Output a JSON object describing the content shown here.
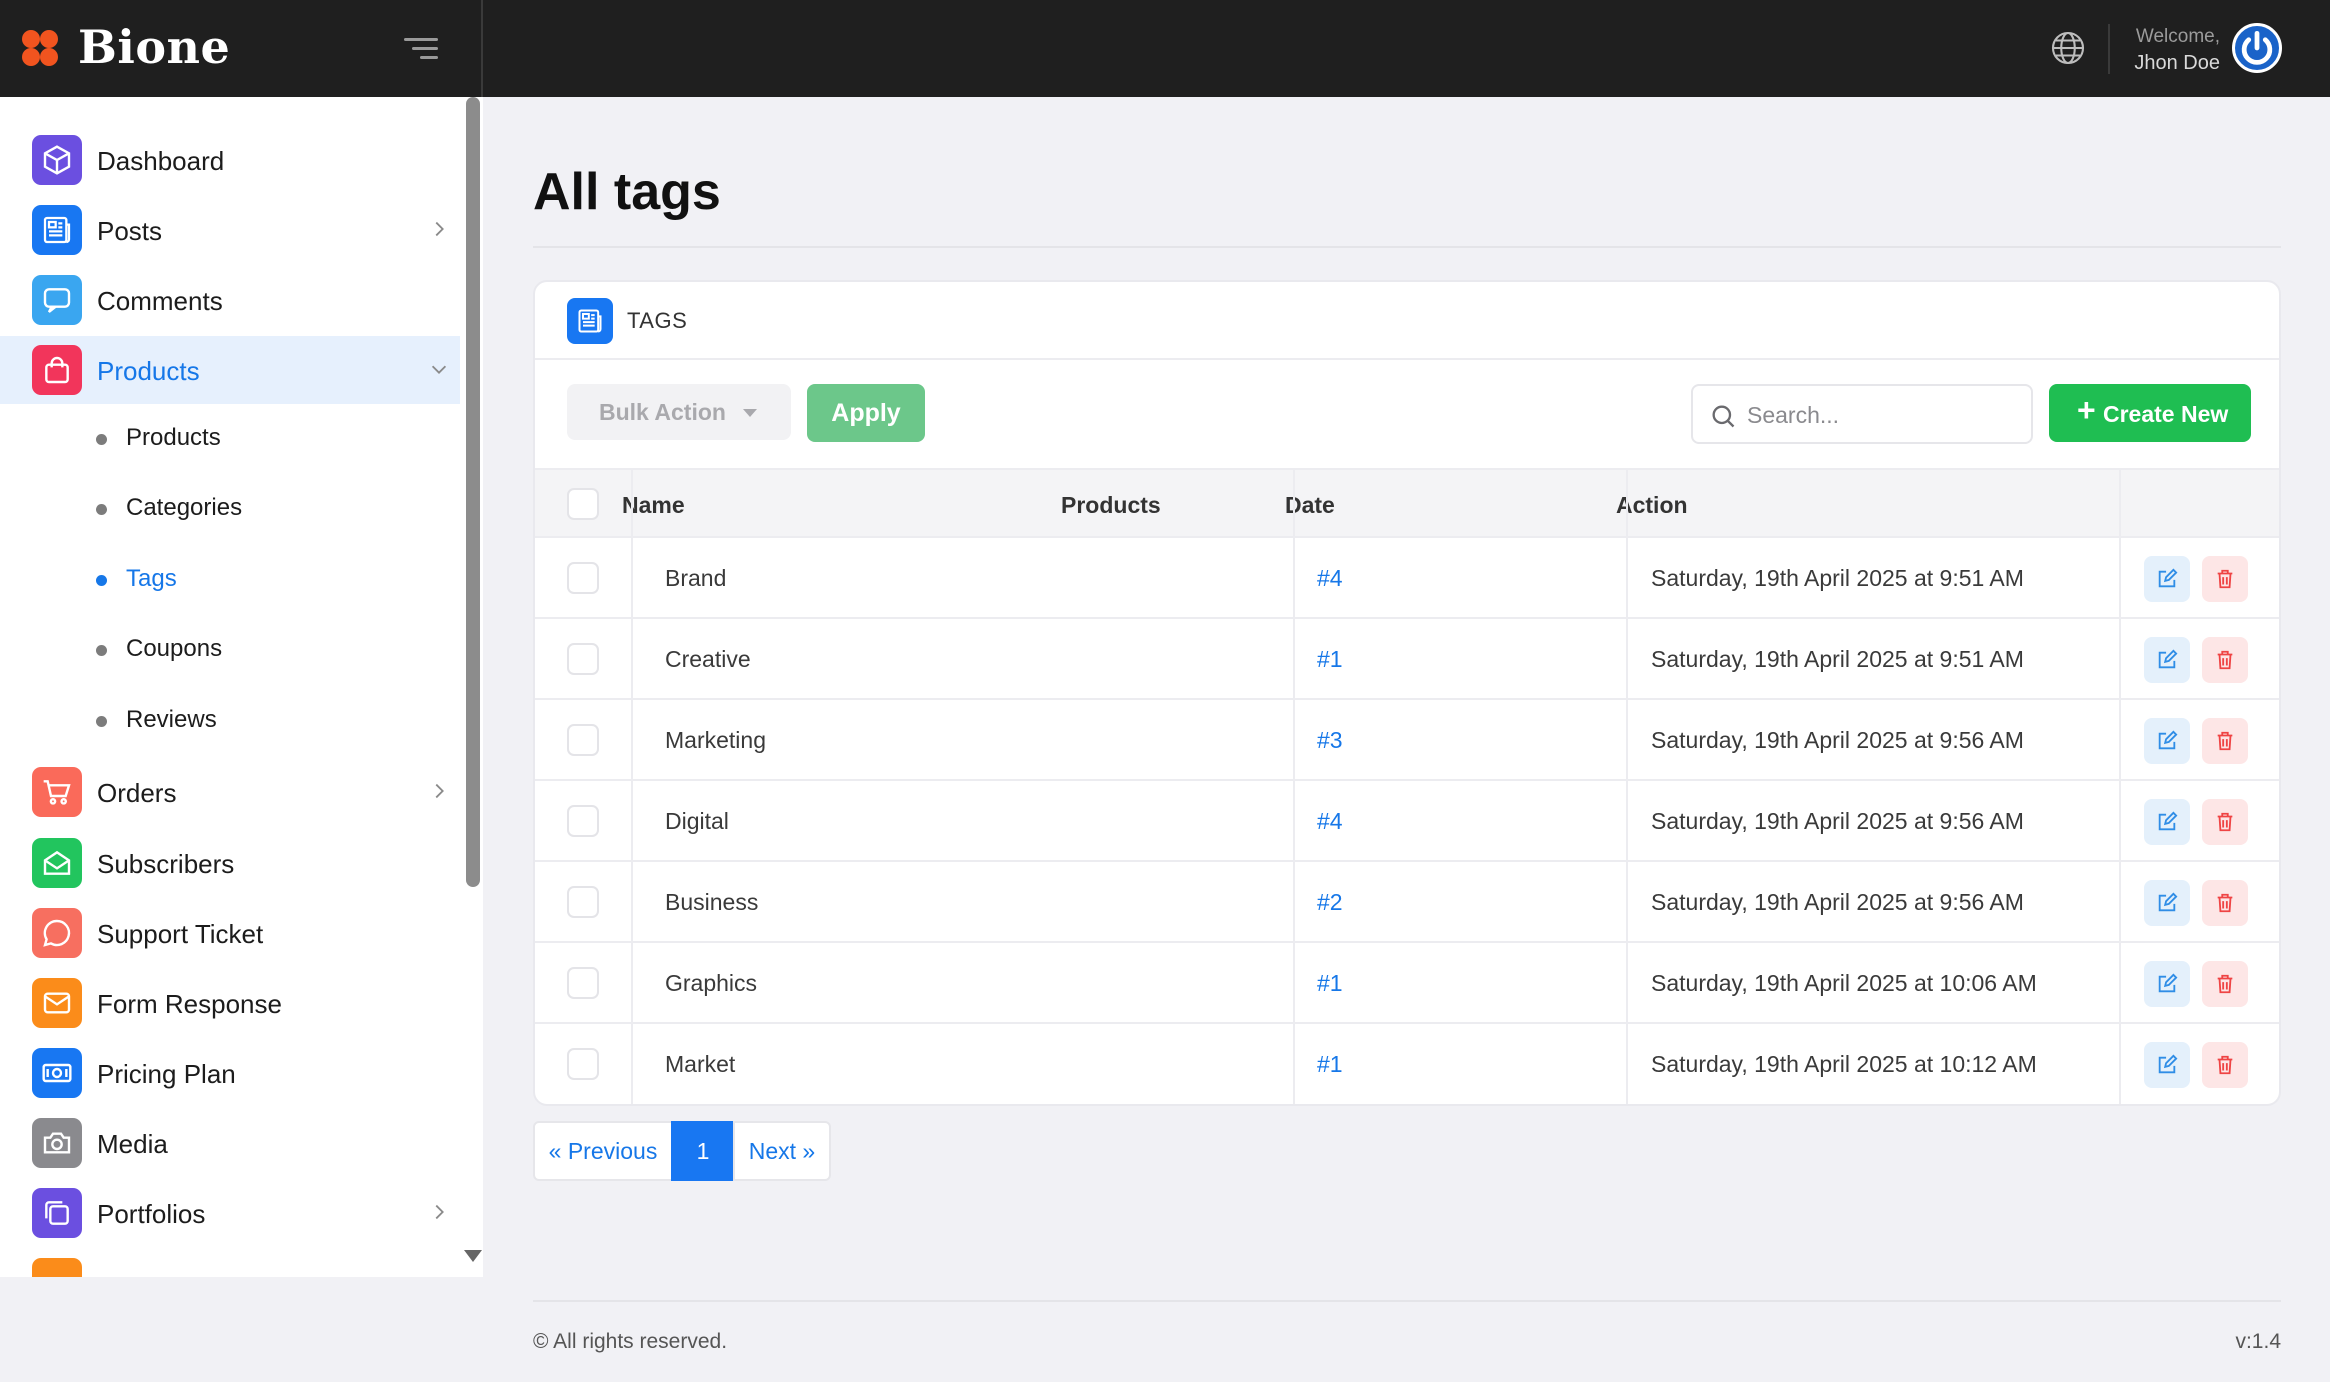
{
  "app": {
    "name": "Bione",
    "brand_color": "#f1541f",
    "accent": "#1877f2"
  },
  "header": {
    "welcome": "Welcome,",
    "user_name": "Jhon Doe"
  },
  "sidebar": {
    "items": [
      {
        "label": "Dashboard",
        "icon": "cube-icon",
        "color": "#6b4fe0"
      },
      {
        "label": "Posts",
        "icon": "newspaper-icon",
        "color": "#1877f2",
        "has_children": true
      },
      {
        "label": "Comments",
        "icon": "comment-icon",
        "color": "#3aa6f0"
      },
      {
        "label": "Products",
        "icon": "shopping-bag-icon",
        "color": "#f2355b",
        "expanded": true
      },
      {
        "label": "Orders",
        "icon": "cart-icon",
        "color": "#fa6a5a",
        "has_children": true
      },
      {
        "label": "Subscribers",
        "icon": "mail-open-icon",
        "color": "#22c55e"
      },
      {
        "label": "Support Ticket",
        "icon": "chat-icon",
        "color": "#f76f60"
      },
      {
        "label": "Form Response",
        "icon": "envelope-icon",
        "color": "#fb8c1a"
      },
      {
        "label": "Pricing Plan",
        "icon": "money-icon",
        "color": "#1877f2"
      },
      {
        "label": "Media",
        "icon": "camera-icon",
        "color": "#8a8a8e"
      },
      {
        "label": "Portfolios",
        "icon": "layers-icon",
        "color": "#6b4fe0",
        "has_children": true
      }
    ],
    "products_sub": [
      "Products",
      "Categories",
      "Tags",
      "Coupons",
      "Reviews"
    ],
    "active_sub": "Tags"
  },
  "page": {
    "title": "All tags"
  },
  "card": {
    "title": "TAGS",
    "bulk_action": "Bulk Action",
    "apply": "Apply",
    "search_placeholder": "Search...",
    "create_new": "Create New"
  },
  "table": {
    "headers": [
      "Name",
      "Products",
      "Date",
      "Action"
    ],
    "rows": [
      {
        "name": "Brand",
        "products": "#4",
        "date": "Saturday, 19th April 2025 at 9:51 AM"
      },
      {
        "name": "Creative",
        "products": "#1",
        "date": "Saturday, 19th April 2025 at 9:51 AM"
      },
      {
        "name": "Marketing",
        "products": "#3",
        "date": "Saturday, 19th April 2025 at 9:56 AM"
      },
      {
        "name": "Digital",
        "products": "#4",
        "date": "Saturday, 19th April 2025 at 9:56 AM"
      },
      {
        "name": "Business",
        "products": "#2",
        "date": "Saturday, 19th April 2025 at 9:56 AM"
      },
      {
        "name": "Graphics",
        "products": "#1",
        "date": "Saturday, 19th April 2025 at 10:06 AM"
      },
      {
        "name": "Market",
        "products": "#1",
        "date": "Saturday, 19th April 2025 at 10:12 AM"
      }
    ]
  },
  "pagination": {
    "previous": "« Previous",
    "current": "1",
    "next": "Next »"
  },
  "footer": {
    "copyright": "© All rights reserved.",
    "version": "v:1.4"
  }
}
